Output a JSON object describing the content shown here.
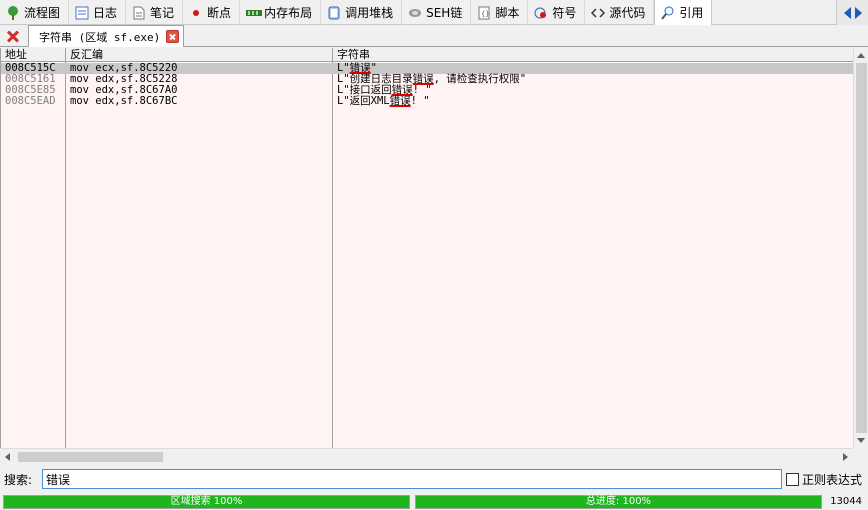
{
  "tabs": [
    {
      "label": "流程图",
      "icon": "tree-icon"
    },
    {
      "label": "日志",
      "icon": "log-icon"
    },
    {
      "label": "笔记",
      "icon": "note-icon"
    },
    {
      "label": "断点",
      "icon": "breakpoint-dot-icon"
    },
    {
      "label": "内存布局",
      "icon": "memory-icon"
    },
    {
      "label": "调用堆栈",
      "icon": "callstack-icon"
    },
    {
      "label": "SEH链",
      "icon": "seh-icon"
    },
    {
      "label": "脚本",
      "icon": "script-icon"
    },
    {
      "label": "符号",
      "icon": "symbol-icon"
    },
    {
      "label": "源代码",
      "icon": "source-code-icon"
    },
    {
      "label": "引用",
      "icon": "search-icon"
    }
  ],
  "subtab": {
    "label": "字符串 (区域 sf.exe)"
  },
  "table": {
    "headers": {
      "addr": "地址",
      "asm": "反汇编",
      "str": "字符串"
    },
    "rows": [
      {
        "addr": "008C515C",
        "asm": "mov ecx,sf.8C5220",
        "str_pre": "L\"",
        "str_hl": "错误",
        "str_post": "\"",
        "selected": true
      },
      {
        "addr": "008C5161",
        "asm": "mov edx,sf.8C5228",
        "str_pre": "L\"创建日志目录",
        "str_hl": "错误",
        "str_post": ", 请检查执行权限\"",
        "selected": false
      },
      {
        "addr": "008C5E85",
        "asm": "mov edx,sf.8C67A0",
        "str_pre": "L\"接口返回",
        "str_hl": "错误",
        "str_post": "! \"",
        "selected": false
      },
      {
        "addr": "008C5EAD",
        "asm": "mov edx,sf.8C67BC",
        "str_pre": "L\"返回XML",
        "str_hl": "错误",
        "str_post": "! \"",
        "selected": false
      }
    ]
  },
  "search": {
    "label": "搜索:",
    "value": "错误",
    "regex_label": "正则表达式",
    "regex_checked": false
  },
  "status": {
    "region_search": "区域搜索 100%",
    "region_progress": 1.0,
    "total": "总进度: 100%",
    "total_progress": 1.0,
    "count": "13044"
  },
  "colors": {
    "accent": "#1fb51f",
    "grid_bg": "#fff3f3",
    "highlight_underline": "#e00000"
  }
}
